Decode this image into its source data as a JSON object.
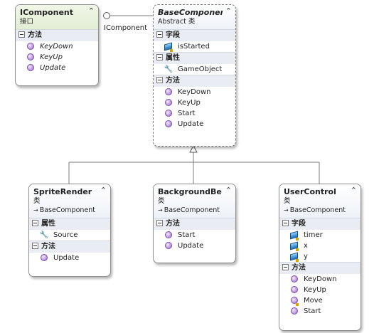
{
  "diagram": {
    "interface_label": "IComponent",
    "icomponent": {
      "name": "IComponent",
      "kind": "接口",
      "sections": [
        {
          "title": "方法",
          "items": [
            "KeyDown",
            "KeyUp",
            "Update"
          ]
        }
      ]
    },
    "base": {
      "name": "BaseComponent",
      "kind": "Abstract 类",
      "sections": [
        {
          "title": "字段",
          "items": [
            "isStarted"
          ]
        },
        {
          "title": "属性",
          "items": [
            "GameObject"
          ]
        },
        {
          "title": "方法",
          "items": [
            "KeyDown",
            "KeyUp",
            "Start",
            "Update"
          ]
        }
      ]
    },
    "sprite": {
      "name": "SpriteRender",
      "kind": "类",
      "parent": "BaseComponent",
      "sections": [
        {
          "title": "属性",
          "items": [
            "Source"
          ]
        },
        {
          "title": "方法",
          "items": [
            "Update"
          ]
        }
      ]
    },
    "background": {
      "name": "BackgroundBe...",
      "kind": "类",
      "parent": "BaseComponent",
      "sections": [
        {
          "title": "方法",
          "items": [
            "Start",
            "Update"
          ]
        }
      ]
    },
    "usercontrol": {
      "name": "UserControl",
      "kind": "类",
      "parent": "BaseComponent",
      "sections": [
        {
          "title": "字段",
          "items": [
            "timer",
            "x",
            "y"
          ]
        },
        {
          "title": "方法",
          "items": [
            "KeyDown",
            "KeyUp",
            "Move",
            "Start"
          ]
        }
      ]
    },
    "collapse_glyph": "⌃"
  }
}
